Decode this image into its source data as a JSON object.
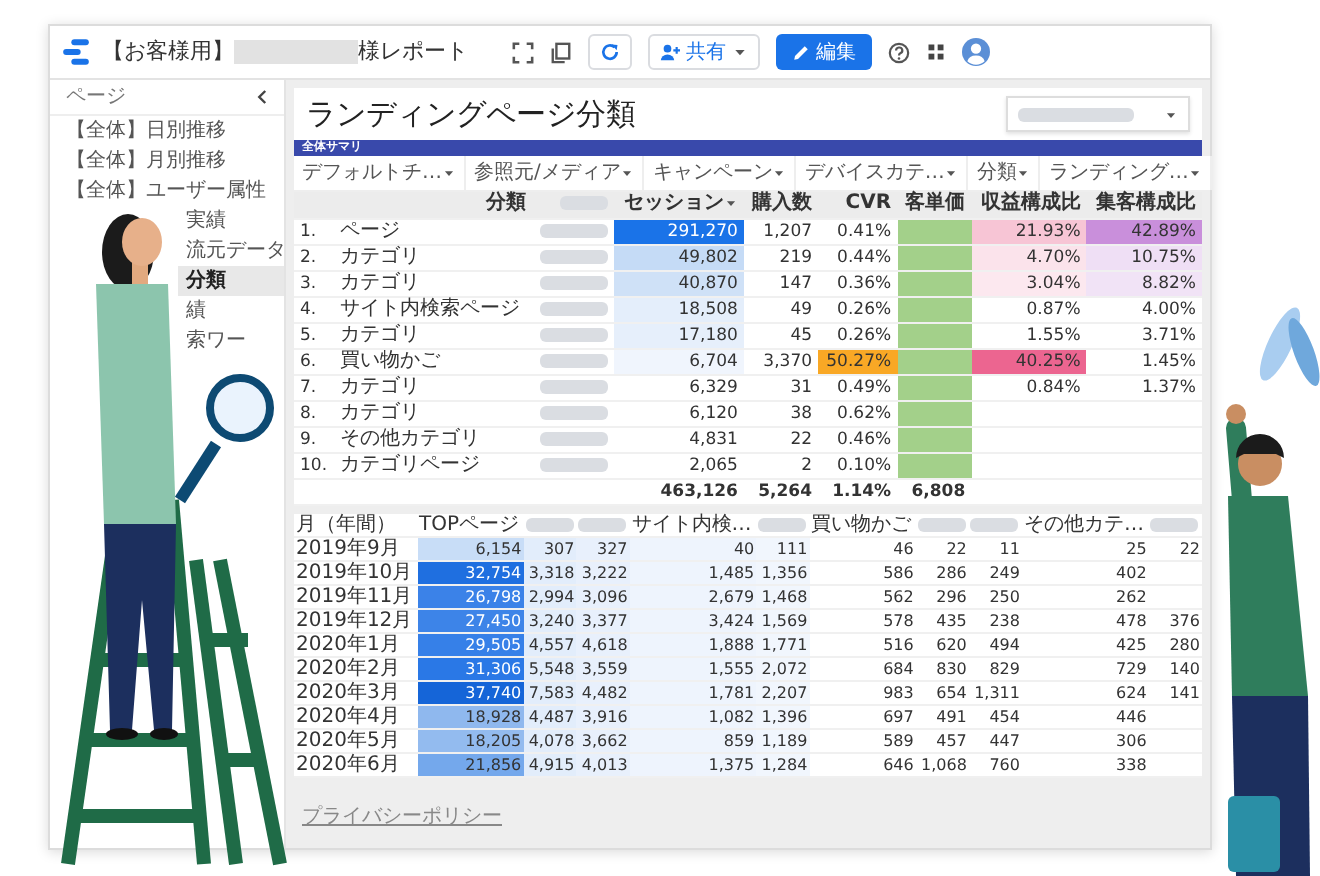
{
  "app_bar": {
    "title_prefix": "【お客様用】",
    "title_suffix": "様レポート",
    "share_label": "共有",
    "edit_label": "編集"
  },
  "sidebar": {
    "heading": "ページ",
    "items": [
      {
        "label": "【全体】日別推移",
        "selected": false,
        "covered": false
      },
      {
        "label": "【全体】月別推移",
        "selected": false,
        "covered": false
      },
      {
        "label": "【全体】ユーザー属性",
        "selected": false,
        "covered": false
      },
      {
        "label": "実績",
        "selected": false,
        "covered": true
      },
      {
        "label": "流元データ",
        "selected": false,
        "covered": true
      },
      {
        "label": "分類",
        "selected": true,
        "covered": true
      },
      {
        "label": "績",
        "selected": false,
        "covered": true
      },
      {
        "label": "索ワー",
        "selected": false,
        "covered": true
      }
    ]
  },
  "report": {
    "title": "ランディングページ分類",
    "section": "全体サマリ",
    "filters": [
      "デフォルトチ…",
      "参照元/メディア",
      "キャンペーン",
      "デバイスカテ…",
      "分類",
      "ランディング…"
    ],
    "summary_table": {
      "columns": [
        {
          "kind": "index"
        },
        {
          "kind": "text",
          "label": "分類"
        },
        {
          "kind": "blurred"
        },
        {
          "kind": "number",
          "label": "セッション",
          "sorted": true
        },
        {
          "kind": "number",
          "label": "購入数"
        },
        {
          "kind": "number",
          "label": "CVR"
        },
        {
          "kind": "blurred",
          "label": "客単価",
          "color": "#a3d08a"
        },
        {
          "kind": "number",
          "label": "収益構成比"
        },
        {
          "kind": "number",
          "label": "集客構成比"
        }
      ],
      "rows": [
        {
          "cells": [
            "1.",
            "ページ",
            null,
            {
              "text": "291,270",
              "color": "#1a73e8"
            },
            "1,207",
            "0.41%",
            null,
            {
              "text": "21.93%",
              "color": "#f7c5d5"
            },
            {
              "text": "42.89%",
              "color": "#c98fdb"
            }
          ]
        },
        {
          "cells": [
            "2.",
            "カテゴリ",
            null,
            {
              "text": "49,802",
              "color": "#c5dbf6"
            },
            "219",
            "0.44%",
            null,
            {
              "text": "4.70%",
              "color": "#fbe3eb"
            },
            {
              "text": "10.75%",
              "color": "#efdff5"
            }
          ]
        },
        {
          "cells": [
            "3.",
            "カテゴリ",
            null,
            {
              "text": "40,870",
              "color": "#cfe1f7"
            },
            "147",
            "0.36%",
            null,
            {
              "text": "3.04%",
              "color": "#fce8ef"
            },
            {
              "text": "8.82%",
              "color": "#f1e3f6"
            }
          ]
        },
        {
          "cells": [
            "4.",
            "サイト内検索ページ",
            null,
            {
              "text": "18,508",
              "color": "#e4eefb"
            },
            "49",
            "0.26%",
            null,
            "0.87%",
            "4.00%"
          ]
        },
        {
          "cells": [
            "5.",
            "カテゴリ",
            null,
            {
              "text": "17,180",
              "color": "#e6effb"
            },
            "45",
            "0.26%",
            null,
            "1.55%",
            "3.71%"
          ]
        },
        {
          "cells": [
            "6.",
            "買い物かご",
            null,
            {
              "text": "6,704",
              "color": "#f0f5fd"
            },
            "3,370",
            {
              "text": "50.27%",
              "color": "#f9a825"
            },
            null,
            {
              "text": "40.25%",
              "color": "#ec6590"
            },
            "1.45%"
          ]
        },
        {
          "cells": [
            "7.",
            "カテゴリ",
            null,
            "6,329",
            "31",
            "0.49%",
            null,
            "0.84%",
            "1.37%"
          ]
        },
        {
          "cells": [
            "8.",
            "カテゴリ",
            null,
            "6,120",
            "38",
            "0.62%",
            null,
            null,
            null
          ]
        },
        {
          "cells": [
            "9.",
            "その他カテゴリ",
            null,
            "4,831",
            "22",
            "0.46%",
            null,
            null,
            null
          ]
        },
        {
          "cells": [
            "10.",
            "カテゴリページ",
            null,
            "2,065",
            "2",
            "0.10%",
            null,
            null,
            null
          ]
        }
      ],
      "total": {
        "cells": [
          null,
          null,
          null,
          "463,126",
          "5,264",
          "1.14%",
          "6,808",
          null,
          null
        ]
      }
    },
    "monthly_table": {
      "columns": [
        {
          "kind": "text",
          "label": "月（年間）"
        },
        {
          "kind": "number",
          "label": "TOPページ"
        },
        {
          "kind": "blurred",
          "color": "#e2edfb"
        },
        {
          "kind": "blurred",
          "color": "#e8f0fc"
        },
        {
          "kind": "number",
          "label": "サイト内検…",
          "color": "#eef4fd"
        },
        {
          "kind": "blurred",
          "color": "#f1f6fd"
        },
        {
          "kind": "number",
          "label": "買い物かご"
        },
        {
          "kind": "blurred"
        },
        {
          "kind": "blurred"
        },
        {
          "kind": "number",
          "label": "その他カテ…"
        },
        {
          "kind": "blurred"
        }
      ],
      "rows": [
        {
          "cells": [
            "2019年9月",
            {
              "text": "6,154",
              "color": "#c8ddf7"
            },
            "307",
            "327",
            "40",
            "111",
            "46",
            "22",
            "11",
            "25",
            "22"
          ]
        },
        {
          "cells": [
            "2019年10月",
            {
              "text": "32,754",
              "color": "#1f6fe0"
            },
            "3,318",
            "3,222",
            "1,485",
            "1,356",
            "586",
            "286",
            "249",
            "402",
            null
          ]
        },
        {
          "cells": [
            "2019年11月",
            {
              "text": "26,798",
              "color": "#3b82e8"
            },
            "2,994",
            "3,096",
            "2,679",
            "1,468",
            "562",
            "296",
            "250",
            "262",
            null
          ]
        },
        {
          "cells": [
            "2019年12月",
            {
              "text": "27,450",
              "color": "#3d84e8"
            },
            "3,240",
            "3,377",
            "3,424",
            "1,569",
            "578",
            "435",
            "238",
            "478",
            "376"
          ]
        },
        {
          "cells": [
            "2020年1月",
            {
              "text": "29,505",
              "color": "#3680e8"
            },
            "4,557",
            "4,618",
            "1,888",
            "1,771",
            "516",
            "620",
            "494",
            "425",
            "280"
          ]
        },
        {
          "cells": [
            "2020年2月",
            {
              "text": "31,306",
              "color": "#2a78e6"
            },
            "5,548",
            "3,559",
            "1,555",
            "2,072",
            "684",
            "830",
            "829",
            "729",
            "140"
          ]
        },
        {
          "cells": [
            "2020年3月",
            {
              "text": "37,740",
              "color": "#1565d8"
            },
            "7,583",
            "4,482",
            "1,781",
            "2,207",
            "983",
            "654",
            "1,311",
            "624",
            "141"
          ]
        },
        {
          "cells": [
            "2020年4月",
            {
              "text": "18,928",
              "color": "#8fb8ee"
            },
            "4,487",
            "3,916",
            "1,082",
            "1,396",
            "697",
            "491",
            "454",
            "446",
            null
          ]
        },
        {
          "cells": [
            "2020年5月",
            {
              "text": "18,205",
              "color": "#93bbef"
            },
            "4,078",
            "3,662",
            "859",
            "1,189",
            "589",
            "457",
            "447",
            "306",
            null
          ]
        },
        {
          "cells": [
            "2020年6月",
            {
              "text": "21,856",
              "color": "#74a8ec"
            },
            "4,915",
            "4,013",
            "1,375",
            "1,284",
            "646",
            "1,068",
            "760",
            "338",
            null
          ]
        }
      ]
    },
    "footer_link": "プライバシーポリシー"
  }
}
